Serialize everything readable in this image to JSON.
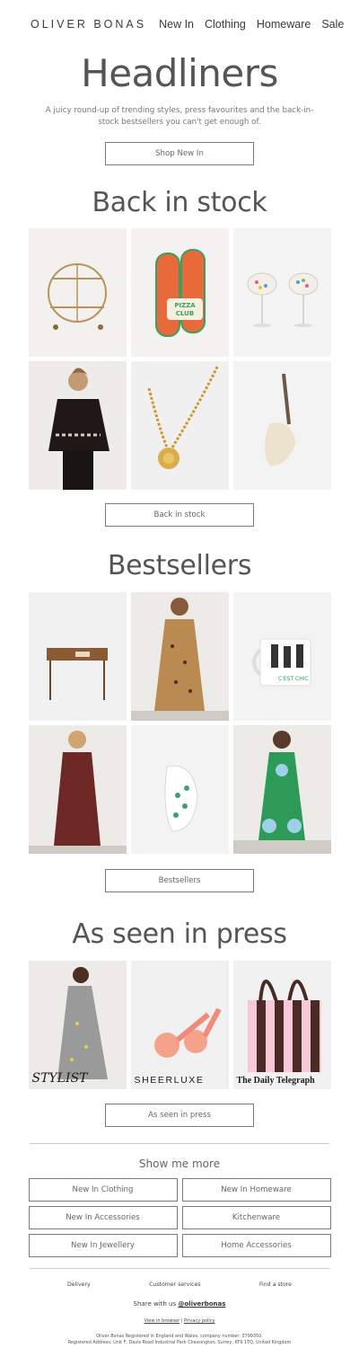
{
  "header": {
    "logo": "OLIVER BONAS",
    "nav": [
      "New In",
      "Clothing",
      "Homeware",
      "Sale"
    ]
  },
  "hero": {
    "title": "Headliners",
    "intro": "A juicy round-up of trending styles, press favourites and the back-in-stock bestsellers you can't get enough of.",
    "cta": "Shop New In"
  },
  "back_in_stock": {
    "title": "Back in stock",
    "cta": "Back in stock",
    "products": [
      "gold-bar-cart",
      "pizza-club-oven-glove",
      "confetti-coupe-glasses",
      "black-embroidered-jacket-model",
      "gold-sunburst-pendant-necklace",
      "cream-leather-sling-bag"
    ]
  },
  "bestsellers": {
    "title": "Bestsellers",
    "cta": "Bestsellers",
    "products": [
      "wooden-console-table",
      "leopard-print-midi-dress-model",
      "cats-mug",
      "red-print-midi-dress-model",
      "spotted-fish-jug",
      "green-floral-dress-model"
    ]
  },
  "press": {
    "title": "As seen in press",
    "cta": "As seen in press",
    "items": [
      {
        "publication": "STYLIST"
      },
      {
        "publication": "SHEERLUXE"
      },
      {
        "publication": "The Daily Telegraph"
      }
    ]
  },
  "more": {
    "title": "Show me more",
    "buttons": [
      "New In Clothing",
      "New In Homeware",
      "New In Accessories",
      "Kitchenware",
      "New In Jewellery",
      "Home Accessories"
    ]
  },
  "footer": {
    "links": [
      "Delivery",
      "Customer services",
      "Find a store"
    ],
    "share_prefix": "Share with us ",
    "share_handle": "@oliverbonas",
    "view_in_browser": "View in browser",
    "separator": " | ",
    "privacy": "Privacy policy",
    "legal_1": "Oliver Bonas Registered in England and Wales, company number: 3799350.",
    "legal_2": "Registered Address: Unit F, Davis Road Industrial Park Chessington, Surrey, KT9 1TQ, United Kingdom"
  }
}
